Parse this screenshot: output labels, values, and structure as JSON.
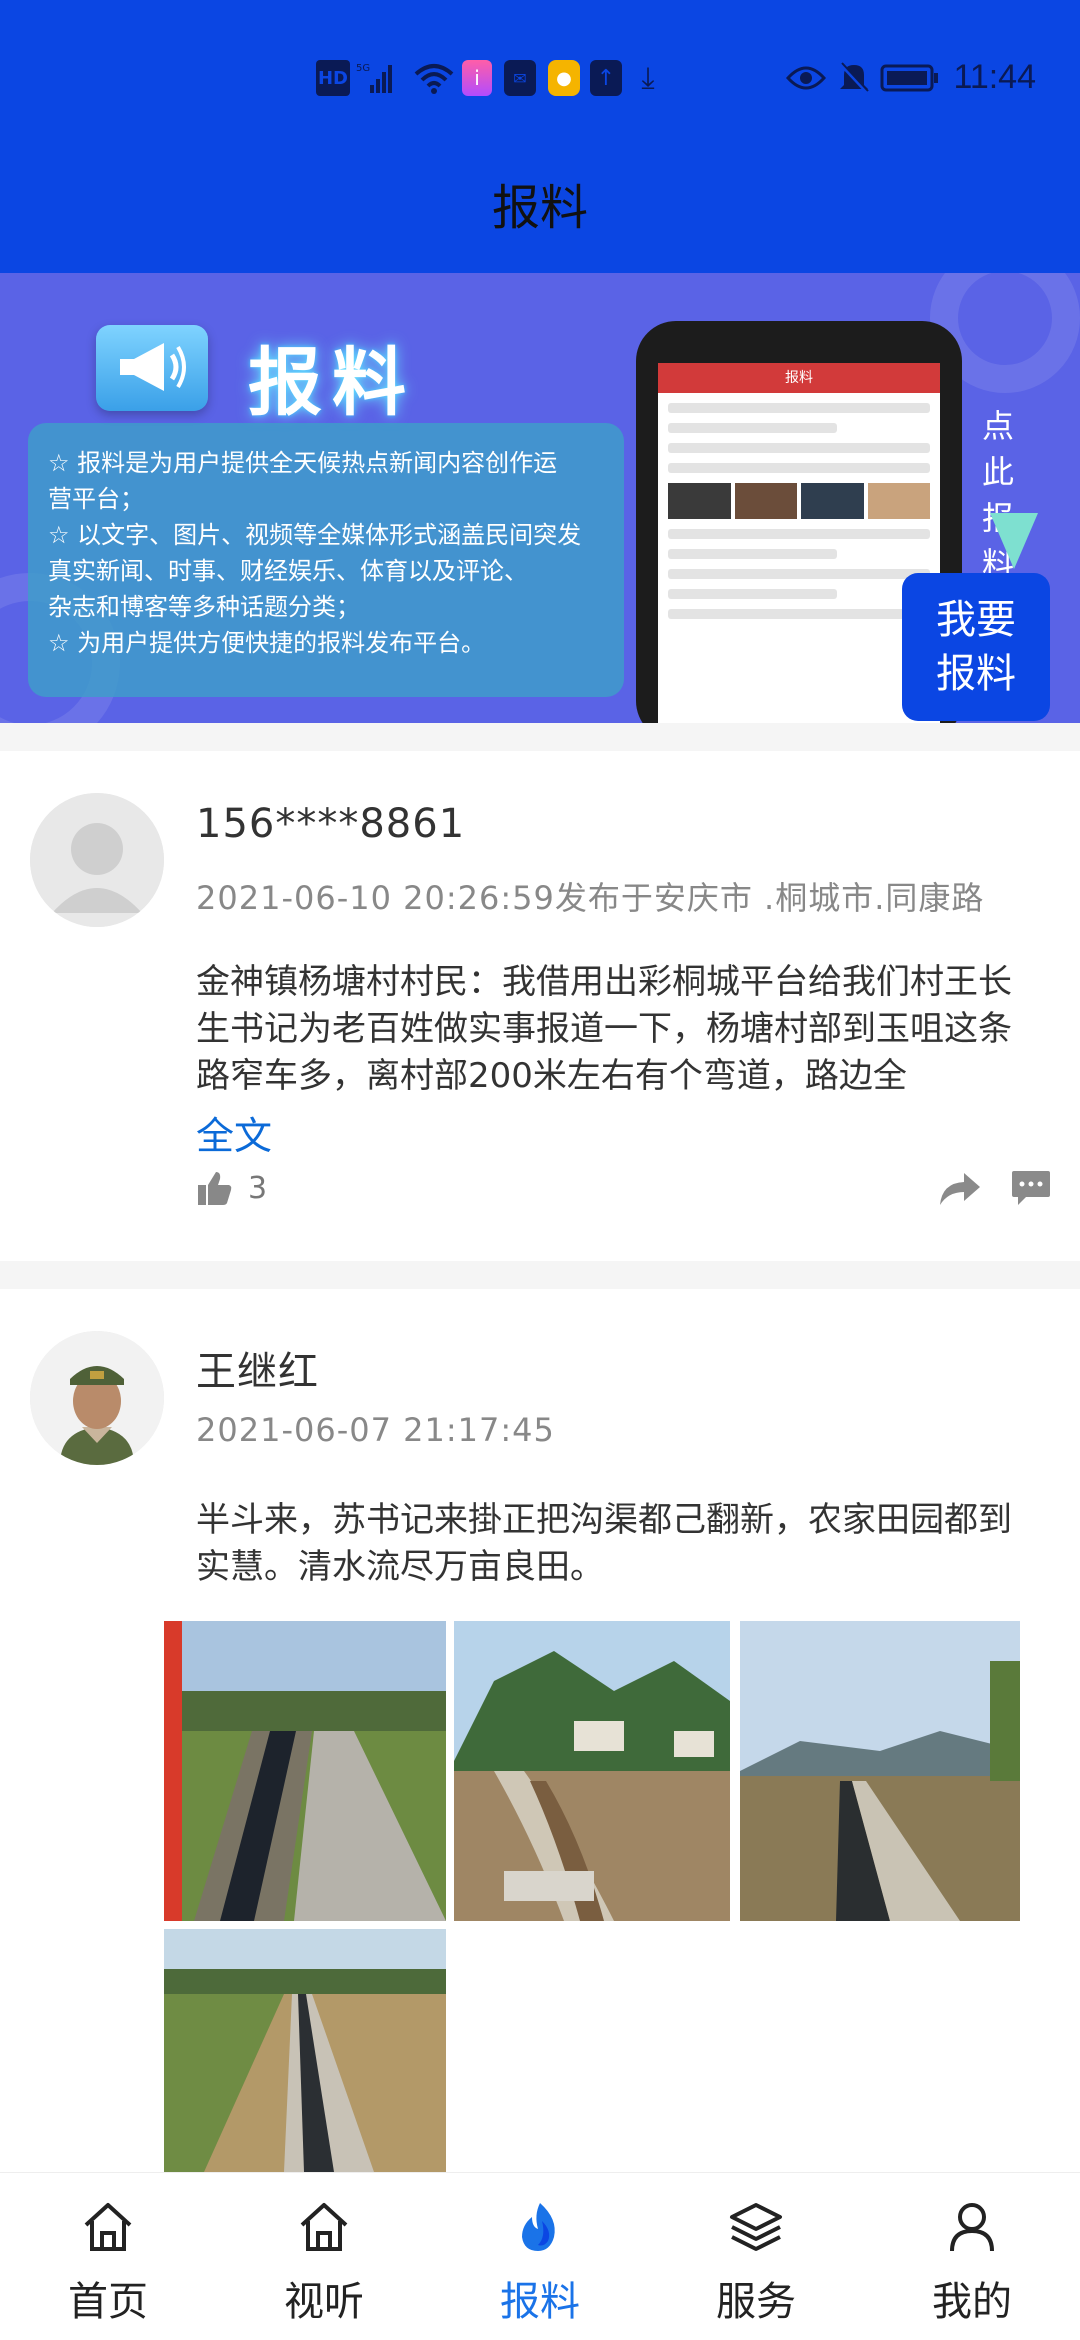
{
  "status_bar": {
    "time": "11:44",
    "icons": [
      "hd-icon",
      "signal-5g-icon",
      "wifi-icon",
      "app-notification-icon",
      "mail-icon",
      "app-icon",
      "upload-icon",
      "download-icon",
      "eye-icon",
      "mute-icon",
      "battery-icon"
    ]
  },
  "header": {
    "title": "报料"
  },
  "banner": {
    "heading": "报料",
    "lines": [
      "☆  报料是为用户提供全天候热点新闻内容创作运",
      "        营平台；",
      "☆ 以文字、图片、视频等全媒体形式涵盖民间突发",
      "      真实新闻、时事、财经娱乐、体育以及评论、",
      "        杂志和博客等多种话题分类；",
      "☆ 为用户提供方便快捷的报料发布平台。"
    ],
    "handwriting": "点此报料",
    "phone_title": "报料"
  },
  "report_button": {
    "line1": "我要",
    "line2": "报料"
  },
  "posts": [
    {
      "user": "156****8861",
      "meta": "2021-06-10  20:26:59发布于安庆市  .桐城市.同康路",
      "text": "金神镇杨塘村村民：我借用出彩桐城平台给我们村王长生书记为老百姓做实事报道一下，杨塘村部到玉咀这条路窄车多，离村部200米左右有个弯道，路边全",
      "full_text_link": "全文",
      "likes": "3"
    },
    {
      "user": "王继红",
      "meta": "2021-06-07  21:17:45",
      "text": "半斗来，苏书记来掛正把沟渠都己翻新，农家田园都到实慧。清水流尽万亩良田。"
    }
  ],
  "nav": {
    "tabs": [
      {
        "label": "首页",
        "icon": "home-icon"
      },
      {
        "label": "视听",
        "icon": "home-icon"
      },
      {
        "label": "报料",
        "icon": "flame-icon"
      },
      {
        "label": "服务",
        "icon": "layers-icon"
      },
      {
        "label": "我的",
        "icon": "user-icon"
      }
    ],
    "active_color": "#1a73e8"
  },
  "colors": {
    "brand_blue": "#0b46e3",
    "link_blue": "#0b6ad8"
  }
}
